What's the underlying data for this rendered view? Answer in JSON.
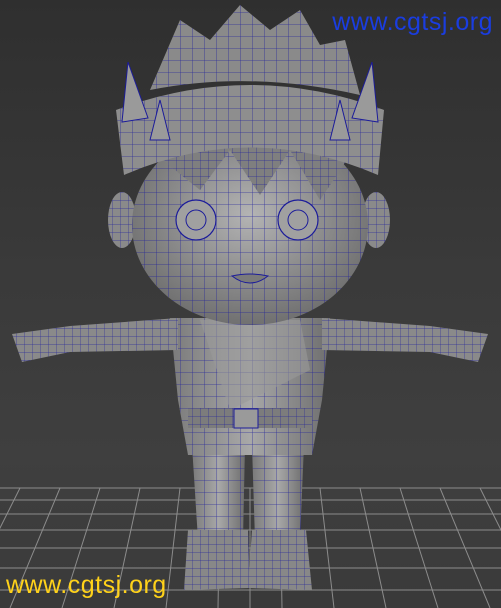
{
  "viewport": {
    "watermark_top": "www.cgtsj.org",
    "watermark_bottom": "www.cgtsj.org",
    "colors": {
      "background": "#3b3b3b",
      "grid_line": "#8c8c8c",
      "mesh_fill": "#8f8f8f",
      "wireframe": "#1a1aa0",
      "watermark_top": "#1a3de0",
      "watermark_bottom": "#ffd21a"
    }
  }
}
